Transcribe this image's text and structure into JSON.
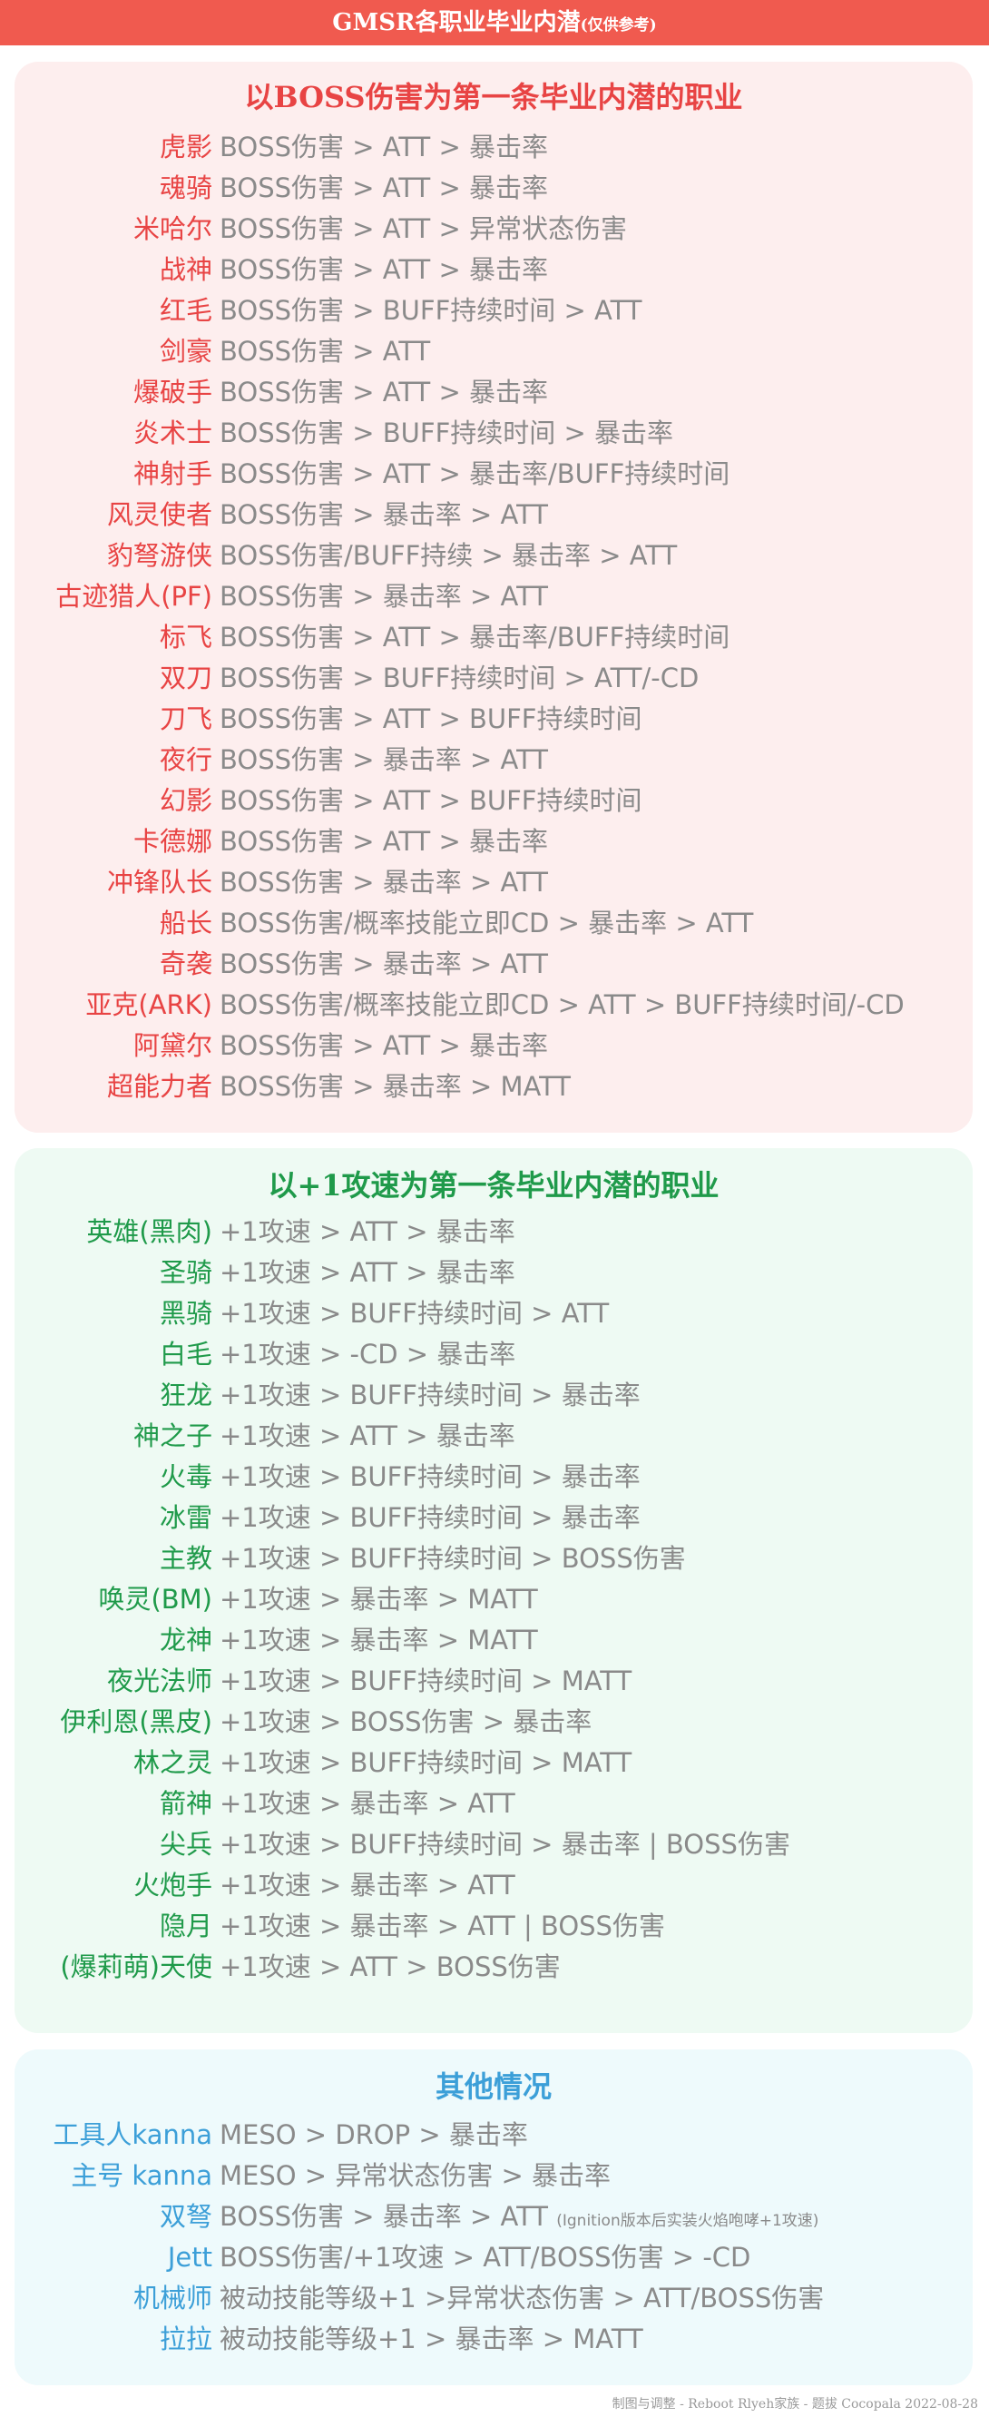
{
  "title": {
    "main": "GMSR各职业毕业内潜",
    "note": "(仅供参考)"
  },
  "sections": [
    {
      "title": "以BOSS伤害为第一条毕业内潜的职业",
      "rows": [
        {
          "job": "虎影",
          "priority": "BOSS伤害 > ATT > 暴击率"
        },
        {
          "job": "魂骑",
          "priority": "BOSS伤害 > ATT > 暴击率"
        },
        {
          "job": "米哈尔",
          "priority": "BOSS伤害 > ATT > 异常状态伤害"
        },
        {
          "job": "战神",
          "priority": "BOSS伤害 > ATT > 暴击率"
        },
        {
          "job": "红毛",
          "priority": "BOSS伤害 > BUFF持续时间 > ATT"
        },
        {
          "job": "剑豪",
          "priority": "BOSS伤害 > ATT"
        },
        {
          "job": "爆破手",
          "priority": "BOSS伤害 > ATT > 暴击率"
        },
        {
          "job": "炎术士",
          "priority": "BOSS伤害 > BUFF持续时间 > 暴击率"
        },
        {
          "job": "神射手",
          "priority": "BOSS伤害 > ATT  > 暴击率/BUFF持续时间"
        },
        {
          "job": "风灵使者",
          "priority": "BOSS伤害 > 暴击率 > ATT"
        },
        {
          "job": "豹弩游侠",
          "priority": "BOSS伤害/BUFF持续 > 暴击率 > ATT"
        },
        {
          "job": "古迹猎人(PF)",
          "priority": "BOSS伤害 > 暴击率 > ATT"
        },
        {
          "job": "标飞",
          "priority": "BOSS伤害 > ATT > 暴击率/BUFF持续时间"
        },
        {
          "job": "双刀",
          "priority": "BOSS伤害 > BUFF持续时间 > ATT/-CD"
        },
        {
          "job": "刀飞",
          "priority": "BOSS伤害 > ATT > BUFF持续时间"
        },
        {
          "job": "夜行",
          "priority": "BOSS伤害 > 暴击率 > ATT"
        },
        {
          "job": "幻影",
          "priority": "BOSS伤害 > ATT > BUFF持续时间"
        },
        {
          "job": "卡德娜",
          "priority": "BOSS伤害 > ATT  > 暴击率"
        },
        {
          "job": "冲锋队长",
          "priority": "BOSS伤害 > 暴击率 > ATT"
        },
        {
          "job": "船长",
          "priority": "BOSS伤害/概率技能立即CD > 暴击率 > ATT"
        },
        {
          "job": "奇袭",
          "priority": "BOSS伤害 > 暴击率 > ATT"
        },
        {
          "job": "亚克(ARK)",
          "priority": "BOSS伤害/概率技能立即CD > ATT  > BUFF持续时间/-CD"
        },
        {
          "job": "阿黛尔",
          "priority": "BOSS伤害 > ATT  > 暴击率"
        },
        {
          "job": "超能力者",
          "priority": "BOSS伤害 > 暴击率 > MATT"
        }
      ]
    },
    {
      "title": "以+1攻速为第一条毕业内潜的职业",
      "rows": [
        {
          "job": "英雄(黑肉)",
          "priority": "+1攻速 > ATT  > 暴击率"
        },
        {
          "job": "圣骑",
          "priority": "+1攻速 > ATT  > 暴击率"
        },
        {
          "job": "黑骑",
          "priority": "+1攻速 > BUFF持续时间  > ATT"
        },
        {
          "job": "白毛",
          "priority": "+1攻速 > -CD > 暴击率"
        },
        {
          "job": "狂龙",
          "priority": "+1攻速 > BUFF持续时间  > 暴击率"
        },
        {
          "job": "神之子",
          "priority": "+1攻速 > ATT  > 暴击率"
        },
        {
          "job": "火毒",
          "priority": "+1攻速 > BUFF持续时间  > 暴击率"
        },
        {
          "job": "冰雷",
          "priority": "+1攻速 > BUFF持续时间  > 暴击率"
        },
        {
          "job": "主教",
          "priority": "+1攻速 > BUFF持续时间  > BOSS伤害"
        },
        {
          "job": "唤灵(BM)",
          "priority": "+1攻速 > 暴击率  > MATT"
        },
        {
          "job": "龙神",
          "priority": "+1攻速 > 暴击率  > MATT"
        },
        {
          "job": "夜光法师",
          "priority": "+1攻速 > BUFF持续时间  > MATT"
        },
        {
          "job": "伊利恩(黑皮)",
          "priority": "+1攻速 > BOSS伤害  > 暴击率"
        },
        {
          "job": "林之灵",
          "priority": "+1攻速 > BUFF持续时间  > MATT"
        },
        {
          "job": "箭神",
          "priority": "+1攻速 > 暴击率  > ATT"
        },
        {
          "job": "尖兵",
          "priority": "+1攻速 > BUFF持续时间  > 暴击率 | BOSS伤害"
        },
        {
          "job": "火炮手",
          "priority": "+1攻速 > 暴击率  > ATT"
        },
        {
          "job": "隐月",
          "priority": "+1攻速 > 暴击率  > ATT | BOSS伤害"
        },
        {
          "job": "(爆莉萌)天使",
          "priority": "+1攻速 > ATT  > BOSS伤害"
        }
      ]
    },
    {
      "title": "其他情况",
      "rows": [
        {
          "job": "工具人kanna",
          "priority": "MESO > DROP > 暴击率"
        },
        {
          "job": "主号 kanna",
          "priority": "MESO > 异常状态伤害 > 暴击率"
        },
        {
          "job": "双弩",
          "priority": "BOSS伤害 > 暴击率 > ATT ",
          "note": "(Ignition版本后实装火焰咆哮+1攻速)"
        },
        {
          "job": "Jett",
          "priority": "BOSS伤害/+1攻速 > ATT/BOSS伤害 > -CD"
        },
        {
          "job": "机械师",
          "priority": "被动技能等级+1 >异常状态伤害 > ATT/BOSS伤害"
        },
        {
          "job": "拉拉",
          "priority": "被动技能等级+1 > 暴击率 > MATT"
        }
      ]
    }
  ],
  "footer": "制图与调整 - Reboot Rlyeh家族 - 题拔 Cocopala  2022-08-28",
  "colors": {
    "title_bar": "#f05a4f",
    "section1_bg": "#fdeeee",
    "section1_accent": "#e84444",
    "section2_bg": "#eefaf3",
    "section2_accent": "#1f9a4a",
    "section3_bg": "#eefafc",
    "section3_accent": "#3c9fd8",
    "priority_text": "#8a8a8a"
  }
}
